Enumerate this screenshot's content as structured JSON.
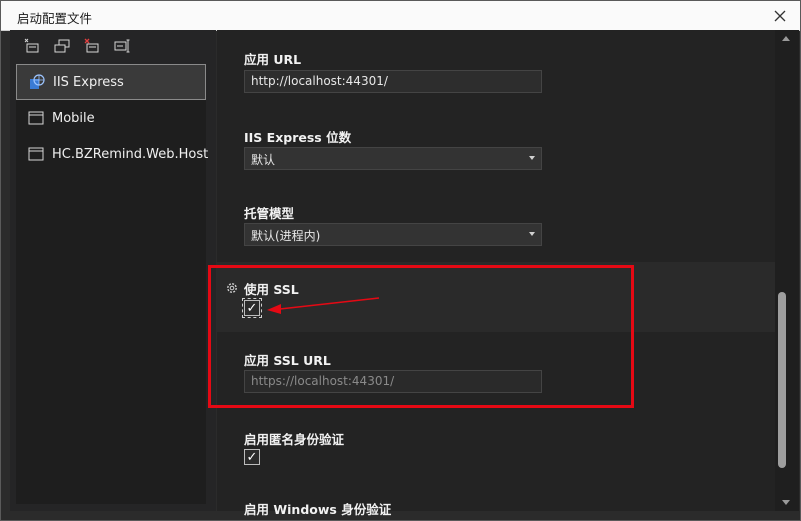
{
  "window": {
    "title": "启动配置文件"
  },
  "sidebar": {
    "toolbar_icons": [
      "new-profile-icon",
      "copy-profile-icon",
      "delete-profile-icon",
      "rename-profile-icon"
    ],
    "profiles": [
      {
        "label": "IIS Express",
        "icon": "iis-globe-icon",
        "selected": true
      },
      {
        "label": "Mobile",
        "icon": "window-icon",
        "selected": false
      },
      {
        "label": "HC.BZRemind.Web.Host",
        "icon": "window-icon",
        "selected": false
      }
    ]
  },
  "form": {
    "app_url": {
      "label": "应用 URL",
      "value": "http://localhost:44301/"
    },
    "bitness": {
      "label": "IIS Express 位数",
      "value": "默认"
    },
    "hosting_model": {
      "label": "托管模型",
      "value": "默认(进程内)"
    },
    "use_ssl": {
      "label": "使用 SSL",
      "checked": true
    },
    "ssl_url": {
      "label": "应用 SSL URL",
      "value": "https://localhost:44301/"
    },
    "anonymous_auth": {
      "label": "启用匿名身份验证",
      "checked": true
    },
    "windows_auth": {
      "label": "启用 Windows 身份验证"
    }
  },
  "colors": {
    "annotation": "#e50914",
    "background": "#2b2b2b"
  }
}
